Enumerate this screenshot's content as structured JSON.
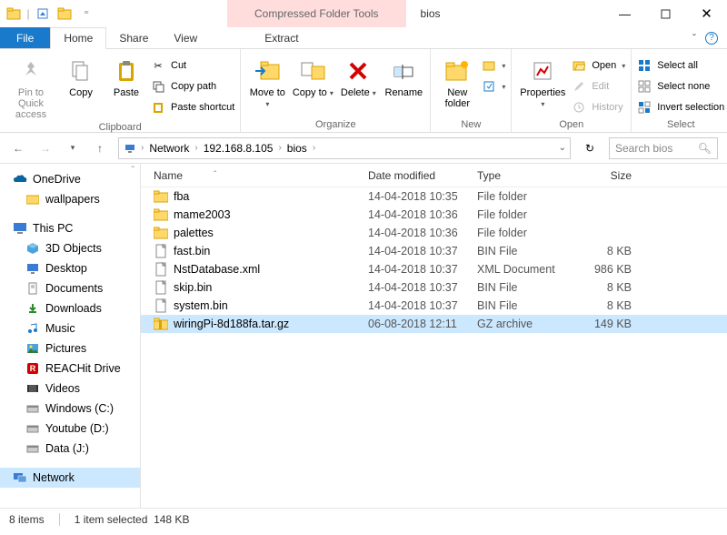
{
  "title": "bios",
  "contextTab": "Compressed Folder Tools",
  "tabsRow": {
    "file": "File",
    "home": "Home",
    "share": "Share",
    "view": "View",
    "extract": "Extract"
  },
  "ribbon": {
    "clipboard": {
      "label": "Clipboard",
      "pin": "Pin to Quick access",
      "copy": "Copy",
      "paste": "Paste",
      "cut": "Cut",
      "copypath": "Copy path",
      "pasteshortcut": "Paste shortcut"
    },
    "organize": {
      "label": "Organize",
      "moveto": "Move to",
      "copyto": "Copy to",
      "delete": "Delete",
      "rename": "Rename"
    },
    "new": {
      "label": "New",
      "newfolder": "New folder"
    },
    "open": {
      "label": "Open",
      "properties": "Properties",
      "open": "Open",
      "edit": "Edit",
      "history": "History"
    },
    "select": {
      "label": "Select",
      "selectall": "Select all",
      "selectnone": "Select none",
      "invert": "Invert selection"
    }
  },
  "breadcrumb": {
    "root": "Network",
    "host": "192.168.8.105",
    "folder": "bios"
  },
  "search": {
    "placeholder": "Search bios"
  },
  "nav": {
    "onedrive": "OneDrive",
    "wallpapers": "wallpapers",
    "thispc": "This PC",
    "items": [
      "3D Objects",
      "Desktop",
      "Documents",
      "Downloads",
      "Music",
      "Pictures",
      "REACHit Drive",
      "Videos",
      "Windows (C:)",
      "Youtube (D:)",
      "Data (J:)"
    ],
    "network": "Network"
  },
  "columns": {
    "name": "Name",
    "date": "Date modified",
    "type": "Type",
    "size": "Size"
  },
  "files": [
    {
      "name": "fba",
      "date": "14-04-2018 10:35",
      "type": "File folder",
      "size": "",
      "icon": "folder"
    },
    {
      "name": "mame2003",
      "date": "14-04-2018 10:36",
      "type": "File folder",
      "size": "",
      "icon": "folder"
    },
    {
      "name": "palettes",
      "date": "14-04-2018 10:36",
      "type": "File folder",
      "size": "",
      "icon": "folder"
    },
    {
      "name": "fast.bin",
      "date": "14-04-2018 10:37",
      "type": "BIN File",
      "size": "8 KB",
      "icon": "file"
    },
    {
      "name": "NstDatabase.xml",
      "date": "14-04-2018 10:37",
      "type": "XML Document",
      "size": "986 KB",
      "icon": "file"
    },
    {
      "name": "skip.bin",
      "date": "14-04-2018 10:37",
      "type": "BIN File",
      "size": "8 KB",
      "icon": "file"
    },
    {
      "name": "system.bin",
      "date": "14-04-2018 10:37",
      "type": "BIN File",
      "size": "8 KB",
      "icon": "file"
    },
    {
      "name": "wiringPi-8d188fa.tar.gz",
      "date": "06-08-2018 12:11",
      "type": "GZ archive",
      "size": "149 KB",
      "icon": "archive",
      "selected": true
    }
  ],
  "status": {
    "count": "8 items",
    "selection": "1 item selected",
    "size": "148 KB"
  }
}
